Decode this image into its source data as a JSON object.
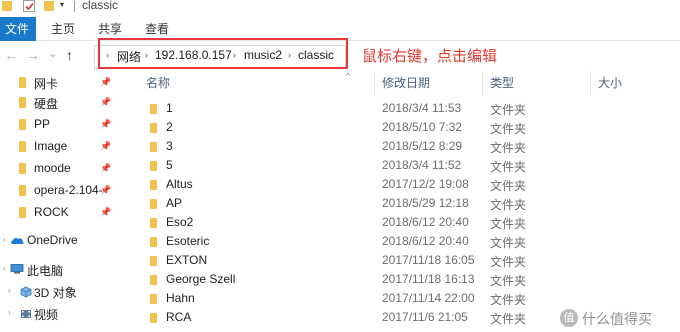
{
  "window": {
    "title": "classic",
    "quick_access_dropdown": "▾"
  },
  "ribbon": {
    "tabs": [
      {
        "label": "文件",
        "active": true
      },
      {
        "label": "主页"
      },
      {
        "label": "共享"
      },
      {
        "label": "查看"
      }
    ]
  },
  "nav": {
    "back": "←",
    "forward": "→",
    "recent": "⌄",
    "up": "↑",
    "breadcrumb": [
      "网络",
      "192.168.0.157",
      "music2",
      "classic"
    ],
    "breadcrumb_separator": "›"
  },
  "annotation": {
    "text": "鼠标右键，点击编辑",
    "color": "#e23a2f"
  },
  "sidebar": {
    "quick_access": [
      {
        "label": "网卡",
        "pinned": true
      },
      {
        "label": "硬盘",
        "pinned": true
      },
      {
        "label": "PP",
        "pinned": true
      },
      {
        "label": "Image",
        "pinned": true
      },
      {
        "label": "moode",
        "pinned": true
      },
      {
        "label": "opera-2.104-",
        "pinned": true
      },
      {
        "label": "ROCK",
        "pinned": true
      }
    ],
    "onedrive": "OneDrive",
    "this_pc": "此电脑",
    "pc_items": [
      "3D 对象",
      "视频"
    ],
    "pin_glyph": "📌",
    "expander_glyph": "›"
  },
  "content": {
    "columns": {
      "name": "名称",
      "date": "修改日期",
      "type": "类型",
      "size": "大小"
    },
    "sort_indicator": "^",
    "rows": [
      {
        "name": "1",
        "date": "2018/3/4 11:53",
        "type": "文件夹"
      },
      {
        "name": "2",
        "date": "2018/5/10 7:32",
        "type": "文件夹"
      },
      {
        "name": "3",
        "date": "2018/5/12 8:29",
        "type": "文件夹"
      },
      {
        "name": "5",
        "date": "2018/3/4 11:52",
        "type": "文件夹"
      },
      {
        "name": "Altus",
        "date": "2017/12/2 19:08",
        "type": "文件夹"
      },
      {
        "name": "AP",
        "date": "2018/5/29 12:18",
        "type": "文件夹"
      },
      {
        "name": "Eso2",
        "date": "2018/6/12 20:40",
        "type": "文件夹"
      },
      {
        "name": "Esoteric",
        "date": "2018/6/12 20:40",
        "type": "文件夹"
      },
      {
        "name": "EXTON",
        "date": "2017/11/18 16:05",
        "type": "文件夹"
      },
      {
        "name": "George Szell",
        "date": "2017/11/18 16:13",
        "type": "文件夹"
      },
      {
        "name": "Hahn",
        "date": "2017/11/14 22:00",
        "type": "文件夹"
      },
      {
        "name": "RCA",
        "date": "2017/11/6 21:05",
        "type": "文件夹"
      }
    ]
  },
  "watermark": {
    "badge": "值",
    "text": "什么值得买"
  },
  "colors": {
    "accent": "#1979ca",
    "folder": "#f0c24e",
    "highlight_box": "#e8363a"
  }
}
